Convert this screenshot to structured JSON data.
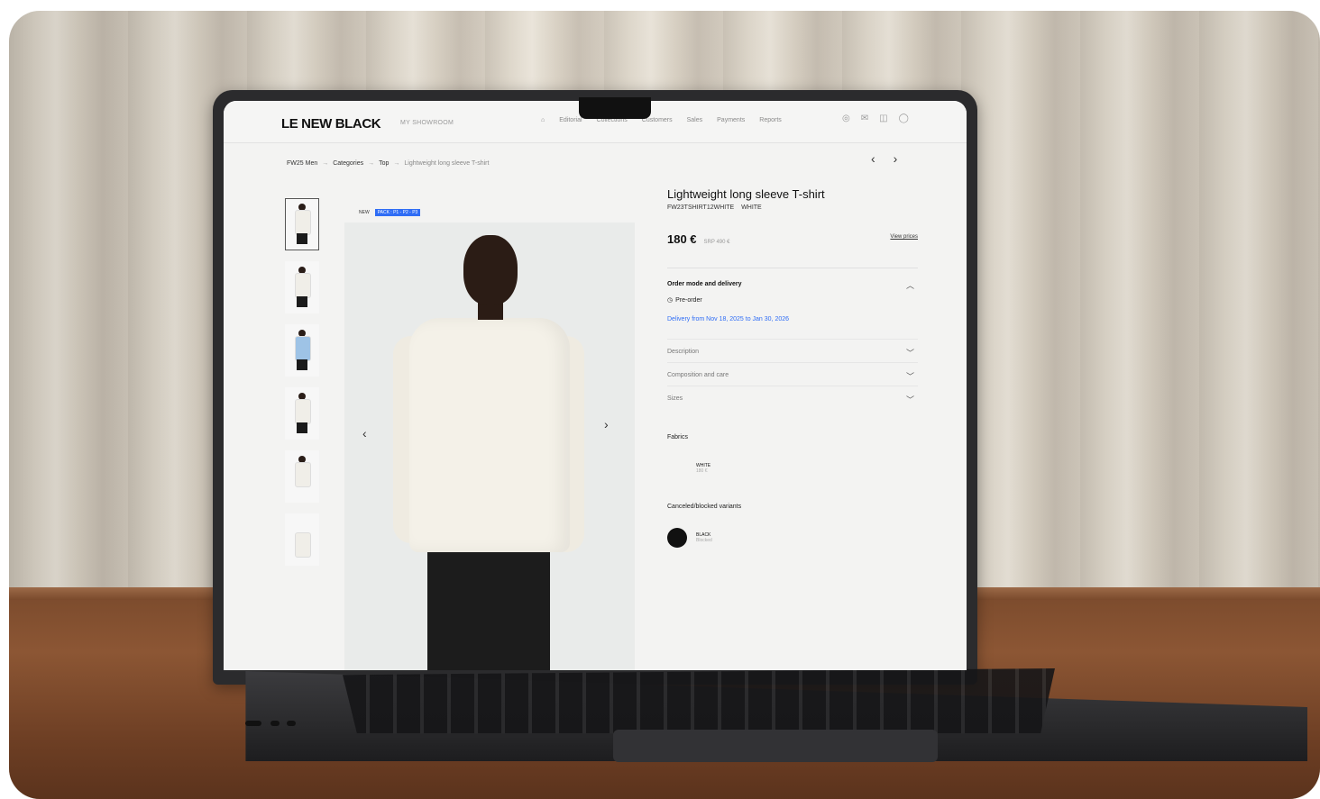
{
  "app": {
    "logo": "LE NEW BLACK",
    "subtitle": "MY SHOWROOM",
    "nav": [
      "Editorial",
      "Collections",
      "Customers",
      "Sales",
      "Payments",
      "Reports"
    ],
    "icons": [
      "home-icon",
      "globe-icon",
      "mail-icon",
      "bag-icon",
      "user-icon"
    ]
  },
  "breadcrumb": [
    "FW25 Men",
    "Categories",
    "Top",
    "Lightweight long sleeve T-shirt"
  ],
  "product": {
    "badge_new": "NEW",
    "badge_pack": "PACK : P1 - P2 - P3",
    "title": "Lightweight long sleeve T-shirt",
    "sku": "FW23TSHIRT12WHITE",
    "color": "WHITE",
    "price": "180 €",
    "srp": "SRP 490 €",
    "view_prices": "View prices"
  },
  "order": {
    "title": "Order mode and delivery",
    "mode": "Pre-order",
    "delivery": "Delivery from Nov 18, 2025 to Jan 30, 2026"
  },
  "accordions": [
    "Description",
    "Composition and care",
    "Sizes"
  ],
  "fabrics": {
    "title": "Fabrics",
    "items": [
      {
        "name": "WHITE",
        "sub": "180 €"
      }
    ]
  },
  "blocked": {
    "title": "Canceled/blocked variants",
    "items": [
      {
        "name": "BLACK",
        "sub": "Blocked"
      }
    ]
  }
}
